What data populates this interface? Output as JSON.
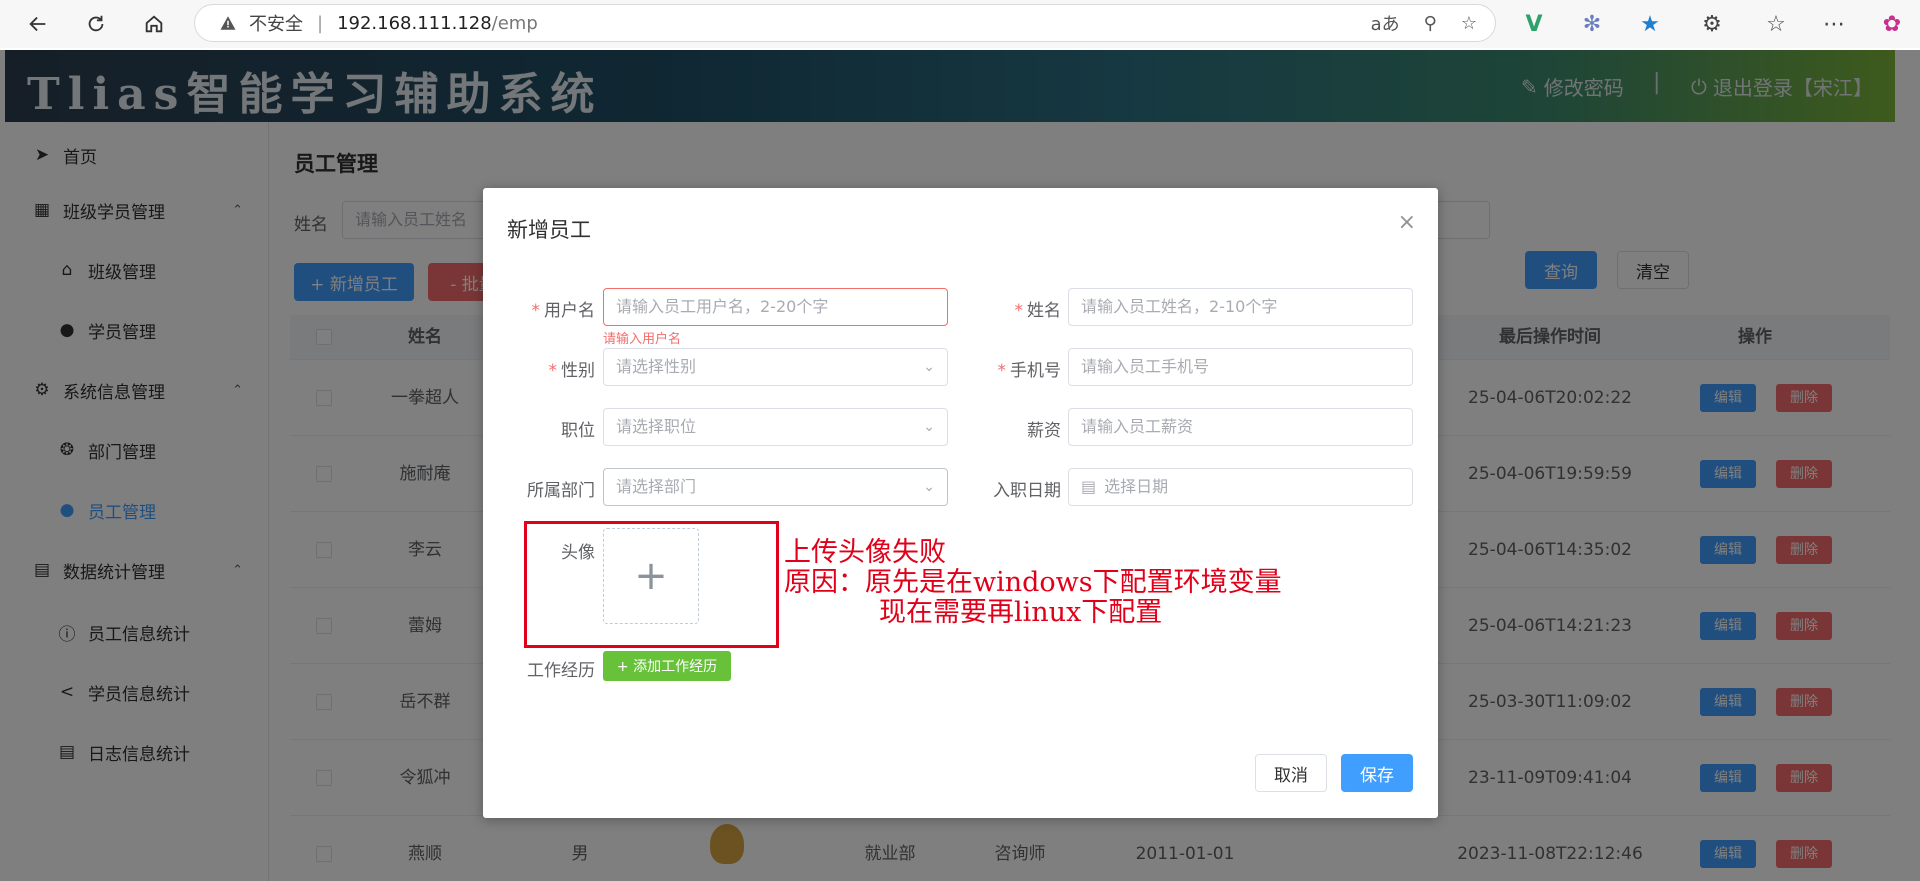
{
  "browser": {
    "insecure": "不安全",
    "host": "192.168.111.128",
    "path": "/emp",
    "read_aloud": "aあ"
  },
  "header": {
    "brand": "Tlias智能学习辅助系统",
    "change_password": "修改密码",
    "separator": "|",
    "logout": "退出登录【宋江】"
  },
  "sidebar": {
    "items": [
      {
        "label": "首页",
        "icon": "paper-plane-icon"
      },
      {
        "label": "班级学员管理",
        "icon": "grid-icon"
      },
      {
        "label": "班级管理",
        "icon": "home-icon"
      },
      {
        "label": "学员管理",
        "icon": "user-icon"
      },
      {
        "label": "系统信息管理",
        "icon": "gear-icon"
      },
      {
        "label": "部门管理",
        "icon": "circle-icon"
      },
      {
        "label": "员工管理",
        "icon": "user-icon"
      },
      {
        "label": "数据统计管理",
        "icon": "chart-icon"
      },
      {
        "label": "员工信息统计",
        "icon": "info-icon"
      },
      {
        "label": "学员信息统计",
        "icon": "share-icon"
      },
      {
        "label": "日志信息统计",
        "icon": "document-icon"
      }
    ]
  },
  "main": {
    "title": "员工管理",
    "filter_label": "姓名",
    "filter_placeholder": "请输入员工姓名",
    "query_btn": "查询",
    "clear_btn": "清空",
    "add_btn": "+ 新增员工",
    "batch_btn": "- 批量",
    "columns": {
      "name": "姓名",
      "last_op": "最后操作时间",
      "actions": "操作"
    },
    "edit": "编辑",
    "delete": "删除",
    "rows": [
      {
        "name": "一拳超人",
        "gender": "",
        "dept": "",
        "job": "",
        "date": "",
        "time": "25-04-06T20:02:22"
      },
      {
        "name": "施耐庵",
        "gender": "",
        "dept": "",
        "job": "",
        "date": "",
        "time": "25-04-06T19:59:59"
      },
      {
        "name": "李云",
        "gender": "",
        "dept": "",
        "job": "",
        "date": "",
        "time": "25-04-06T14:35:02"
      },
      {
        "name": "蕾姆",
        "gender": "",
        "dept": "",
        "job": "",
        "date": "",
        "time": "25-04-06T14:21:23"
      },
      {
        "name": "岳不群",
        "gender": "",
        "dept": "",
        "job": "",
        "date": "",
        "time": "25-03-30T11:09:02"
      },
      {
        "name": "令狐冲",
        "gender": "",
        "dept": "",
        "job": "",
        "date": "",
        "time": "23-11-09T09:41:04"
      },
      {
        "name": "燕顺",
        "gender": "男",
        "dept": "就业部",
        "job": "咨询师",
        "date": "2011-01-01",
        "time": "2023-11-08T22:12:46"
      }
    ]
  },
  "dialog": {
    "title": "新增员工",
    "close": "×",
    "username_label": "用户名",
    "username_placeholder": "请输入员工用户名，2-20个字",
    "username_error": "请输入用户名",
    "name_label": "姓名",
    "name_placeholder": "请输入员工姓名，2-10个字",
    "gender_label": "性别",
    "gender_placeholder": "请选择性别",
    "phone_label": "手机号",
    "phone_placeholder": "请输入员工手机号",
    "job_label": "职位",
    "job_placeholder": "请选择职位",
    "salary_label": "薪资",
    "salary_placeholder": "请输入员工薪资",
    "dept_label": "所属部门",
    "dept_placeholder": "请选择部门",
    "entry_label": "入职日期",
    "entry_placeholder": "选择日期",
    "avatar_label": "头像",
    "work_label": "工作经历",
    "add_work_btn": "+ 添加工作经历",
    "cancel": "取消",
    "save": "保存"
  },
  "annotation": {
    "line1": "上传头像失败",
    "line2": "原因：原先是在windows下配置环境变量",
    "line3": "现在需要再linux下配置"
  }
}
